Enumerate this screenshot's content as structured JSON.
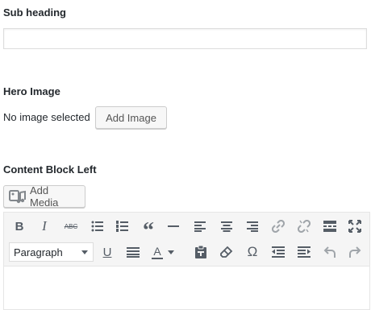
{
  "sub_heading": {
    "label": "Sub heading",
    "value": ""
  },
  "hero_image": {
    "label": "Hero Image",
    "status_text": "No image selected",
    "button_label": "Add Image"
  },
  "content_block_left": {
    "label": "Content Block Left",
    "add_media_label": "Add Media",
    "toolbar": {
      "row1": [
        "bold",
        "italic",
        "strikethrough",
        "bulleted-list",
        "numbered-list",
        "blockquote",
        "horizontal-line",
        "align-left",
        "align-center",
        "align-right",
        "insert-link",
        "remove-link",
        "read-more",
        "fullscreen"
      ],
      "row2": [
        "paragraph-format",
        "underline",
        "justify",
        "text-color",
        "paste-as-text",
        "clear-formatting",
        "special-character",
        "decrease-indent",
        "increase-indent",
        "undo",
        "redo"
      ],
      "bold_glyph": "B",
      "italic_glyph": "I",
      "strike_glyph": "ABC",
      "underline_glyph": "U",
      "color_glyph": "A",
      "omega_glyph": "Ω",
      "quote_glyph": "“",
      "format_selected": "Paragraph"
    },
    "accent_color": "#555d66",
    "disabled_color": "#a0a5aa"
  }
}
